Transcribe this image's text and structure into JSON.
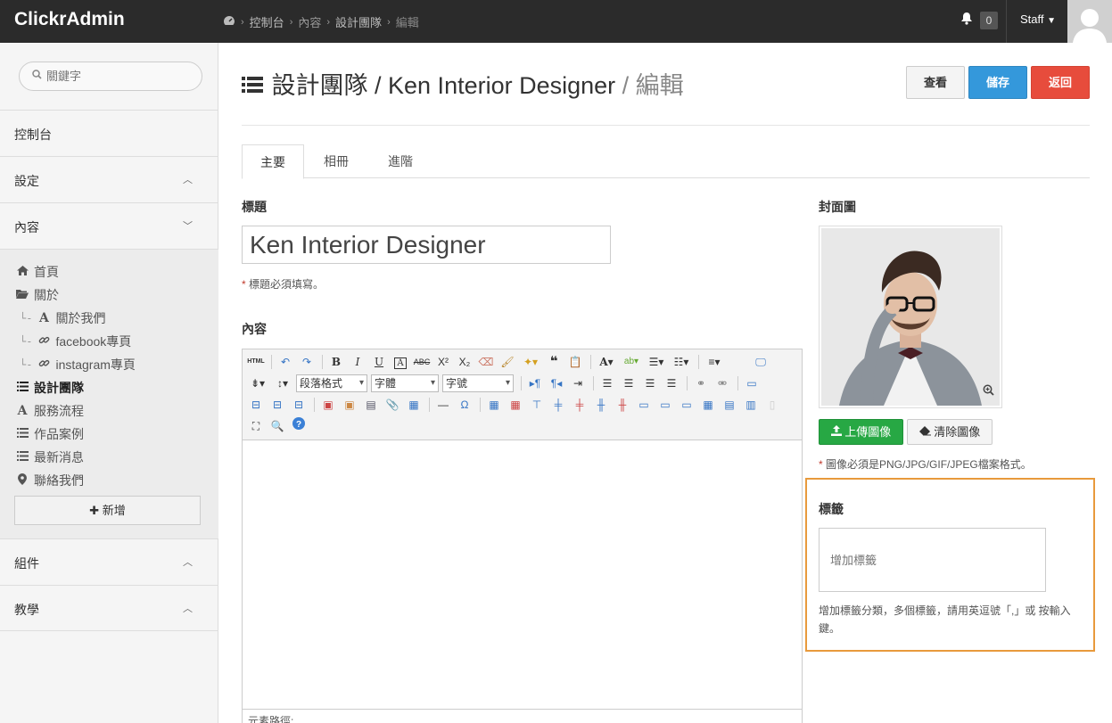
{
  "app": {
    "brand": "ClickrAdmin"
  },
  "breadcrumb": [
    "控制台",
    "內容",
    "設計團隊",
    "編輯"
  ],
  "topbar": {
    "notification_count": "0",
    "user_label": "Staff"
  },
  "sidebar": {
    "search_placeholder": "關鍵字",
    "sections": {
      "dashboard": "控制台",
      "settings": "設定",
      "content": "內容",
      "components": "組件",
      "tutorial": "教學"
    },
    "items": [
      {
        "label": "首頁",
        "icon": "home-icon"
      },
      {
        "label": "關於",
        "icon": "folder-open-icon"
      },
      {
        "label": "關於我們",
        "icon": "font-icon"
      },
      {
        "label": "facebook專頁",
        "icon": "link-icon"
      },
      {
        "label": "instagram專頁",
        "icon": "link-icon"
      },
      {
        "label": "設計團隊",
        "icon": "list-icon"
      },
      {
        "label": "服務流程",
        "icon": "font-icon"
      },
      {
        "label": "作品案例",
        "icon": "list-icon"
      },
      {
        "label": "最新消息",
        "icon": "list-icon"
      },
      {
        "label": "聯絡我們",
        "icon": "map-marker-icon"
      }
    ],
    "add_label": "新增"
  },
  "page": {
    "title_main": "設計團隊 / Ken Interior Designer",
    "title_sep": " / ",
    "title_action": "編輯",
    "buttons": {
      "view": "查看",
      "save": "儲存",
      "back": "返回"
    },
    "tabs": [
      "主要",
      "相冊",
      "進階"
    ]
  },
  "form": {
    "title_label": "標題",
    "title_value": "Ken Interior Designer",
    "title_hint": "標題必須填寫。",
    "content_label": "內容",
    "editor": {
      "paragraph_select": "段落格式",
      "font_select": "字體",
      "size_select": "字號",
      "source_label": "HTML",
      "path_label": "元素路徑:"
    },
    "cover_label": "封面圖",
    "upload_label": "上傳圖像",
    "clear_label": "清除圖像",
    "cover_hint": "圖像必須是PNG/JPG/GIF/JPEG檔案格式。",
    "tags_label": "標籤",
    "tags_placeholder": "增加標籤",
    "tags_help": "增加標籤分類，多個標籤，請用英逗號「,」或 按輸入鍵。"
  },
  "colors": {
    "save": "#3498db",
    "back": "#e74c3c",
    "upload": "#27a844",
    "highlight": "#e89a3c"
  }
}
